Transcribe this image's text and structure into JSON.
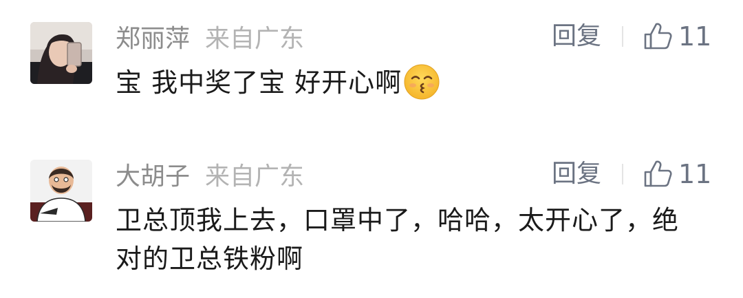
{
  "comments": [
    {
      "username": "郑丽萍",
      "location": "来自广东",
      "text": "宝 我中奖了宝 好开心啊",
      "emoji": "kissing-smiling-eyes-emoji",
      "reply_label": "回复",
      "likes": "11"
    },
    {
      "username": "大胡子",
      "location": "来自广东",
      "text": "卫总顶我上去，口罩中了，哈哈，太开心了，绝对的卫总铁粉啊",
      "reply_label": "回复",
      "likes": "11"
    }
  ],
  "colors": {
    "username": "#8c8c8c",
    "location": "#b3b3b3",
    "action": "#6b7382",
    "text": "#1a1a1a"
  }
}
